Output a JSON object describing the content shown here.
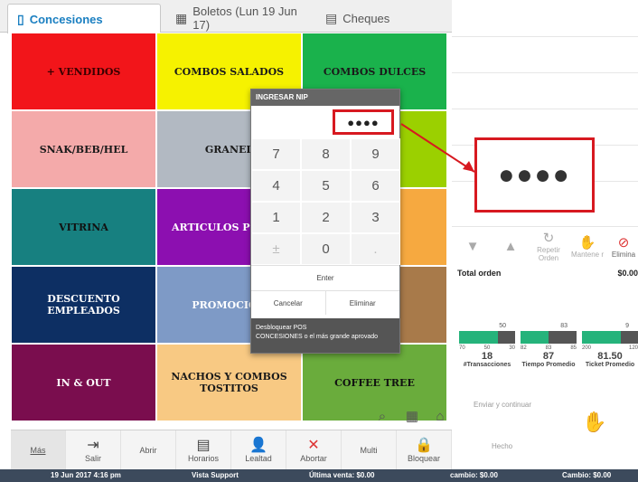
{
  "tabs": [
    {
      "icon": "ticket-icon",
      "label": "Concesiones",
      "active": true
    },
    {
      "icon": "building-icon",
      "label": "Boletos (Lun 19 Jun 17)",
      "active": false
    },
    {
      "icon": "checks-icon",
      "label": "Cheques",
      "active": false
    }
  ],
  "grid": [
    {
      "label": "+ VENDIDOS",
      "color": "#f2151a"
    },
    {
      "label": "COMBOS SALADOS",
      "color": "#f6f200"
    },
    {
      "label": "COMBOS DULCES",
      "color": "#1ab24c"
    },
    {
      "label": "SNAK/BEB/HEL",
      "color": "#f4aaaa"
    },
    {
      "label": "GRANEL",
      "color": "#b2b9c2"
    },
    {
      "label": "S",
      "color": "#9bd000"
    },
    {
      "label": "VITRINA",
      "color": "#178080"
    },
    {
      "label": "ARTICULOS PROMO",
      "color": "#8c0fb0"
    },
    {
      "label": "ESIAS",
      "color": "#f6a940"
    },
    {
      "label": "DESCUENTO EMPLEADOS",
      "color": "#0d2f63"
    },
    {
      "label": "PROMOCION",
      "color": "#7e9ac6"
    },
    {
      "label": "RIALES",
      "color": "#a87a4a"
    },
    {
      "label": "IN & OUT",
      "color": "#7a0d4e"
    },
    {
      "label": "NACHOS Y COMBOS TOSTITOS",
      "color": "#f8c983"
    },
    {
      "label": "COFFEE TREE",
      "color": "#6aac3c"
    }
  ],
  "dialog": {
    "title": "INGRESAR NIP",
    "nip": "●●●●",
    "keys": [
      "7",
      "8",
      "9",
      "4",
      "5",
      "6",
      "1",
      "2",
      "3",
      "±",
      "0",
      "."
    ],
    "enter": "Enter",
    "cancel": "Cancelar",
    "delete": "Eliminar",
    "footer_1": "Desbloquear POS",
    "footer_2": "CONCESIONES o el más grande aprovado"
  },
  "zoom_dots": "●●●●",
  "toolbar": [
    {
      "name": "mas",
      "label": "Más",
      "icon": ""
    },
    {
      "name": "salir",
      "label": "Salir",
      "icon": "exit-icon"
    },
    {
      "name": "abrir",
      "label": "Abrir",
      "icon": ""
    },
    {
      "name": "horarios",
      "label": "Horarios",
      "icon": "calendar-icon"
    },
    {
      "name": "lealtad",
      "label": "Lealtad",
      "icon": "user-icon"
    },
    {
      "name": "abortar",
      "label": "Abortar",
      "icon": "x-icon"
    },
    {
      "name": "multi",
      "label": "Multi",
      "icon": ""
    },
    {
      "name": "bloquear",
      "label": "Bloquear",
      "icon": "lock-icon"
    }
  ],
  "right": {
    "controls": [
      {
        "label": "",
        "icon": "arrow-down-icon"
      },
      {
        "label": "",
        "icon": "arrow-up-icon"
      },
      {
        "label": "Repetir Orden",
        "icon": "repeat-icon"
      },
      {
        "label": "Mantene r",
        "icon": "hand-icon"
      },
      {
        "label": "Elimina",
        "icon": "prohibited-icon"
      }
    ],
    "total_label": "Total orden",
    "total_value": "$0.00",
    "metrics": [
      {
        "top": "50",
        "scale": [
          "70",
          "50",
          "30"
        ],
        "value": "18",
        "label": "#Transacciones",
        "fill": 0.7
      },
      {
        "top": "83",
        "scale": [
          "82",
          "83",
          "85"
        ],
        "value": "87",
        "label": "Tiempo Promedio",
        "fill": 0.5
      },
      {
        "top": "9",
        "scale": [
          "200",
          "",
          "120"
        ],
        "value": "81.50",
        "label": "Ticket Promedio",
        "fill": 0.7
      }
    ],
    "send_label": "Enviar y continuar",
    "done_label": "Hecho"
  },
  "status": {
    "date": "19 Jun 2017 4:16 pm",
    "user": "Vista Support",
    "last_sale": "Última venta: $0.00",
    "change1": "cambio: $0.00",
    "change2": "Cambio: $0.00"
  }
}
